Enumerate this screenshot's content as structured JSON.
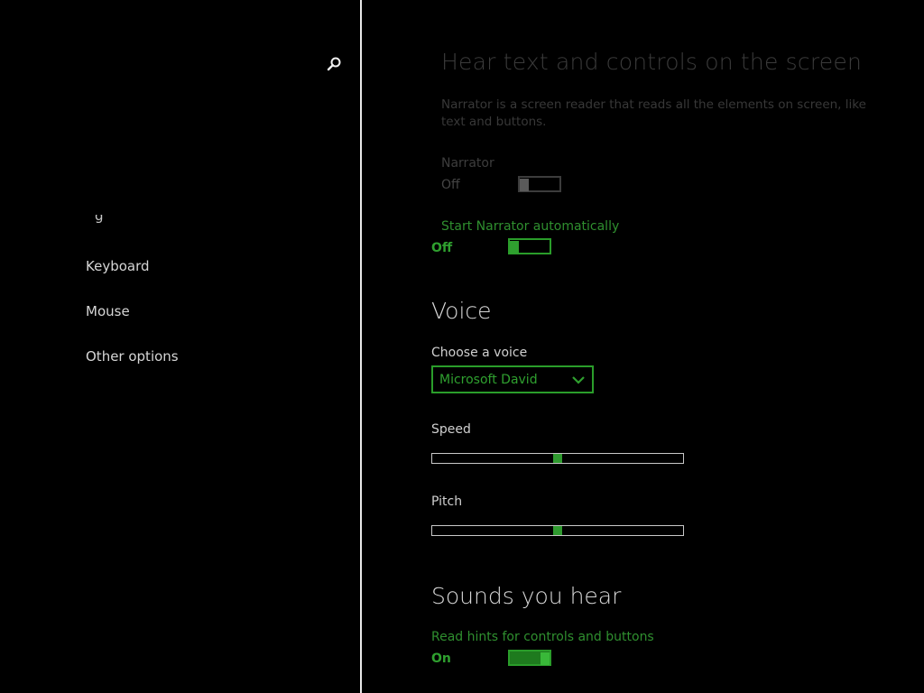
{
  "sidebar": {
    "partial_item": "g",
    "items": [
      {
        "label": "Keyboard"
      },
      {
        "label": "Mouse"
      },
      {
        "label": "Other options"
      }
    ]
  },
  "main": {
    "title": "Hear text and controls on the screen",
    "description": "Narrator is a screen reader that reads all the elements on screen, like text and buttons.",
    "narrator": {
      "label": "Narrator",
      "state": "Off",
      "on": false
    },
    "start_auto": {
      "label_partial": "Start Narrator automatically",
      "state": "Off",
      "on": false
    },
    "voice_section": "Voice",
    "choose_voice_label": "Choose a voice",
    "voice_selected": "Microsoft David",
    "speed": {
      "label": "Speed",
      "level": 0.5
    },
    "pitch": {
      "label": "Pitch",
      "level": 0.5
    },
    "sounds_section": "Sounds you hear",
    "read_hints": {
      "label": "Read hints for controls and buttons",
      "state": "On",
      "on": true
    }
  },
  "colors": {
    "accent": "#2fa02f",
    "background": "#000000",
    "divider": "#e8e8e8",
    "dim_text": "#3a3a3a"
  },
  "icons": {
    "search": "search-icon",
    "chevron": "chevron-down-icon"
  }
}
